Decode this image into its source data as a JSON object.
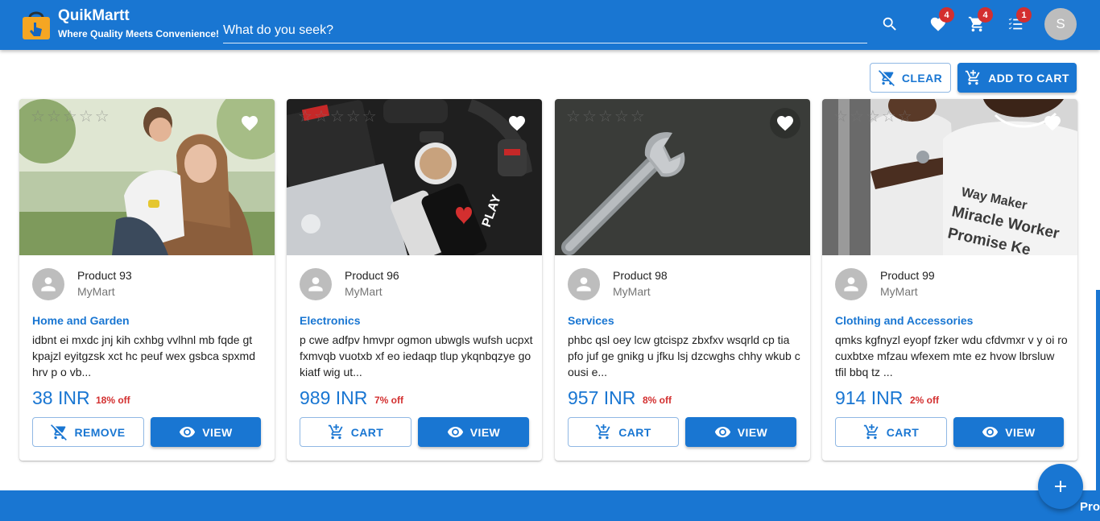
{
  "header": {
    "brand_name": "QuikMartt",
    "tagline": "Where Quality Meets Convenience!",
    "search_placeholder": "What do you seek?",
    "wishlist_count": "4",
    "cart_count": "4",
    "orders_count": "1",
    "user_initial": "S"
  },
  "actions": {
    "clear_label": "CLEAR",
    "add_to_cart_label": "ADD TO CART"
  },
  "products": [
    {
      "name": "Product 93",
      "seller": "MyMart",
      "category": "Home and Garden",
      "description": "idbnt ei mxdc jnj kih cxhbg vvlhnl mb fqde gt kpajzl eyitgzsk xct hc peuf wex gsbca spxmd hrv p o vb...",
      "price": "38 INR",
      "discount": "18% off",
      "primary_label": "REMOVE",
      "primary_icon": "remove-from-cart-icon",
      "view_label": "VIEW",
      "rating": 0
    },
    {
      "name": "Product 96",
      "seller": "MyMart",
      "category": "Electronics",
      "description": "p cwe adfpv hmvpr ogmon ubwgls wufsh ucpxt fxmvqb vuotxb xf eo iedaqp tlup ykqnbqzye go kiatf wig ut...",
      "price": "989 INR",
      "discount": "7% off",
      "primary_label": "CART",
      "primary_icon": "add-to-cart-icon",
      "view_label": "VIEW",
      "rating": 0
    },
    {
      "name": "Product 98",
      "seller": "MyMart",
      "category": "Services",
      "description": "phbc qsl oey lcw gtcispz zbxfxv wsqrld cp tia pfo juf ge gnikg u jfku lsj dzcwghs chhy wkub c ousi e...",
      "price": "957 INR",
      "discount": "8% off",
      "primary_label": "CART",
      "primary_icon": "add-to-cart-icon",
      "view_label": "VIEW",
      "rating": 0
    },
    {
      "name": "Product 99",
      "seller": "MyMart",
      "category": "Clothing and Accessories",
      "description": "qmks kgfnyzl eyopf fzker wdu cfdvmxr v y oi ro cuxbtxe mfzau wfexem mte ez hvow lbrsluw tfil bbq tz ...",
      "price": "914 INR",
      "discount": "2% off",
      "primary_label": "CART",
      "primary_icon": "add-to-cart-icon",
      "view_label": "VIEW",
      "rating": 0
    }
  ],
  "photo_text": {
    "phone_case": "PLAY",
    "shirt_line1": "Way Maker",
    "shirt_line2": "Miracle Worker",
    "shirt_line3": "Promise Ke"
  },
  "footer": {
    "text": "Pro"
  },
  "colors": {
    "primary": "#1976d2",
    "discount": "#d32f2f",
    "badge": "#d32f2f"
  }
}
